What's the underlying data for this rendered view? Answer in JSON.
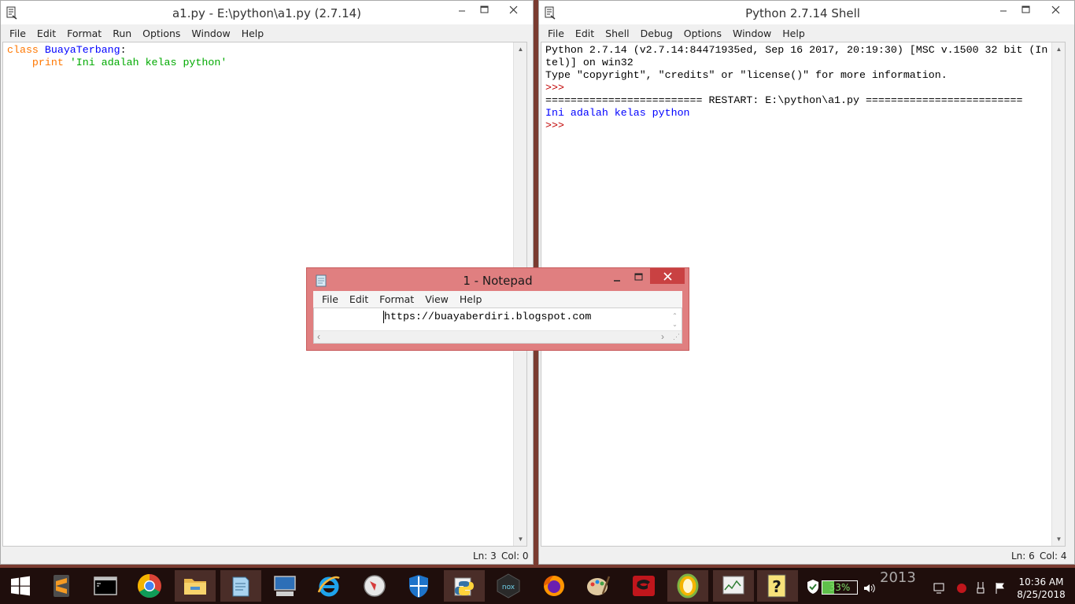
{
  "editor_window": {
    "title": "a1.py - E:\\python\\a1.py (2.7.14)",
    "menu": [
      "File",
      "Edit",
      "Format",
      "Run",
      "Options",
      "Window",
      "Help"
    ],
    "code": {
      "line1_keyword": "class",
      "line1_name": "BuayaTerbang",
      "line1_colon": ":",
      "line2_indent": "    ",
      "line2_keyword": "print",
      "line2_string": "'Ini adalah kelas python'"
    },
    "status": {
      "ln": "Ln: 3",
      "col": "Col: 0"
    }
  },
  "shell_window": {
    "title": "Python 2.7.14 Shell",
    "menu": [
      "File",
      "Edit",
      "Shell",
      "Debug",
      "Options",
      "Window",
      "Help"
    ],
    "lines": {
      "banner1": "Python 2.7.14 (v2.7.14:84471935ed, Sep 16 2017, 20:19:30) [MSC v.1500 32 bit (In",
      "banner2": "tel)] on win32",
      "banner3": "Type \"copyright\", \"credits\" or \"license()\" for more information.",
      "prompt1": ">>> ",
      "restart": "========================= RESTART: E:\\python\\a1.py =========================",
      "output": "Ini adalah kelas python",
      "prompt2": ">>> "
    },
    "status": {
      "ln": "Ln: 6",
      "col": "Col: 4"
    }
  },
  "notepad_window": {
    "title": "1 - Notepad",
    "menu": [
      "File",
      "Edit",
      "Format",
      "View",
      "Help"
    ],
    "content": "https://buayaberdiri.blogspot.com"
  },
  "taskbar": {
    "items": [
      "start",
      "sublime-text",
      "command-prompt",
      "chrome",
      "file-explorer",
      "notepad",
      "remote-desktop",
      "internet-explorer",
      "safari-compass",
      "windows-defender",
      "python",
      "nox",
      "firefox",
      "paint",
      "garena",
      "app-orange",
      "task-manager",
      "help"
    ],
    "battery": "33%",
    "time": "10:36 AM",
    "date": "8/25/2018",
    "watermark": "2013"
  },
  "colors": {
    "keyword": "#ff7700",
    "definition": "#0000ff",
    "string": "#00aa00",
    "notepad_frame": "#e07f80",
    "taskbar": "#1f0e0c"
  }
}
